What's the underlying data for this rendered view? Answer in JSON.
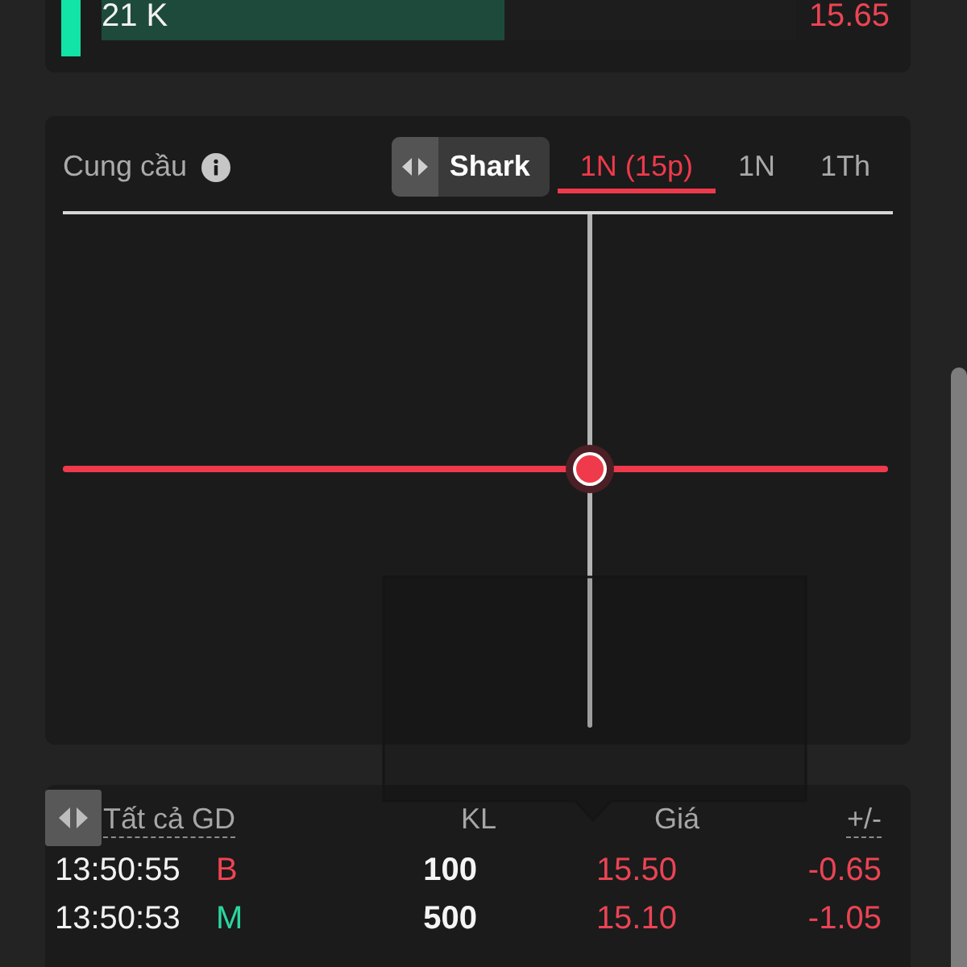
{
  "order_row": {
    "volume_bar": {
      "label": "21 K",
      "level": 0.58
    },
    "price": "15.65"
  },
  "supply_demand": {
    "title": "Cung cầu",
    "toggle": {
      "label": "Shark"
    },
    "tabs": [
      {
        "label": "1N (15p)",
        "selected": true
      },
      {
        "label": "1N",
        "selected": false
      },
      {
        "label": "1Th",
        "selected": false
      }
    ]
  },
  "trades": {
    "columns": [
      {
        "label": "Tất cả GD",
        "underlined": true
      },
      {
        "label": "KL",
        "underlined": false
      },
      {
        "label": "Giá",
        "underlined": false
      },
      {
        "label": "+/-",
        "underlined": true
      }
    ],
    "rows": [
      {
        "time": "13:50:55",
        "side": {
          "label": "B",
          "color": "#ef4452"
        },
        "volume": "100",
        "price": "15.50",
        "change": "-0.65"
      },
      {
        "time": "13:50:53",
        "side": {
          "label": "M",
          "color": "#2bd6a0"
        },
        "volume": "500",
        "price": "15.10",
        "change": "-1.05"
      }
    ]
  }
}
